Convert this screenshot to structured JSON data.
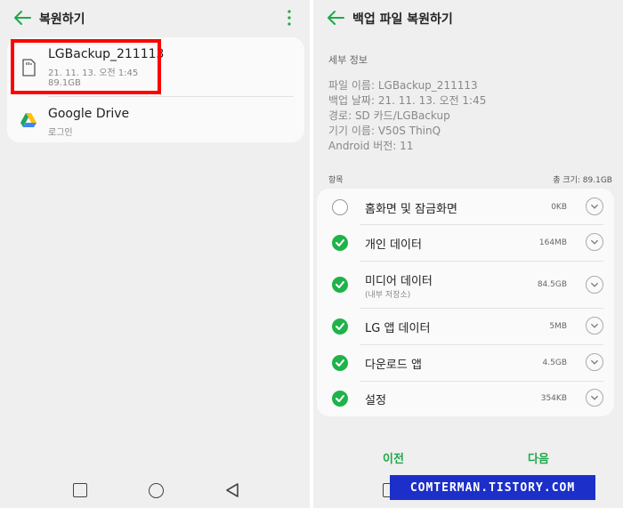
{
  "colors": {
    "accent": "#1fa84a",
    "check": "#1fb34a",
    "highlight": "#ff0000",
    "watermark_bg": "#1c2fc9"
  },
  "left": {
    "header": {
      "title": "복원하기",
      "back_icon": "arrow-left-icon",
      "more_icon": "more-vertical-icon"
    },
    "items": [
      {
        "title": "LGBackup_211113",
        "date": "21. 11. 13. 오전 1:45",
        "size": "89.1GB",
        "icon": "sd-card-icon"
      },
      {
        "title": "Google Drive",
        "sub": "로그인",
        "icon": "google-drive-icon"
      }
    ]
  },
  "right": {
    "header": {
      "title": "백업 파일 복원하기",
      "back_icon": "arrow-left-icon"
    },
    "details_label": "세부 정보",
    "details": [
      "파일 이름: LGBackup_211113",
      "백업 날짜: 21. 11. 13. 오전 1:45",
      "경로: SD 카드/LGBackup",
      "기기 이름: V50S ThinQ",
      "Android 버전: 11"
    ],
    "items_label": "항목",
    "total_size": "총 크기: 89.1GB",
    "rows": [
      {
        "name": "홈화면 및 잠금화면",
        "size": "0KB",
        "checked": false
      },
      {
        "name": "개인 데이터",
        "size": "164MB",
        "checked": true
      },
      {
        "name": "미디어 데이터",
        "sub": "(내부 저장소)",
        "size": "84.5GB",
        "checked": true
      },
      {
        "name": "LG 앱 데이터",
        "size": "5MB",
        "checked": true
      },
      {
        "name": "다운로드 앱",
        "size": "4.5GB",
        "checked": true
      },
      {
        "name": "설정",
        "size": "354KB",
        "checked": true
      }
    ],
    "prev_label": "이전",
    "next_label": "다음"
  },
  "watermark": "COMTERMAN.TISTORY.COM"
}
